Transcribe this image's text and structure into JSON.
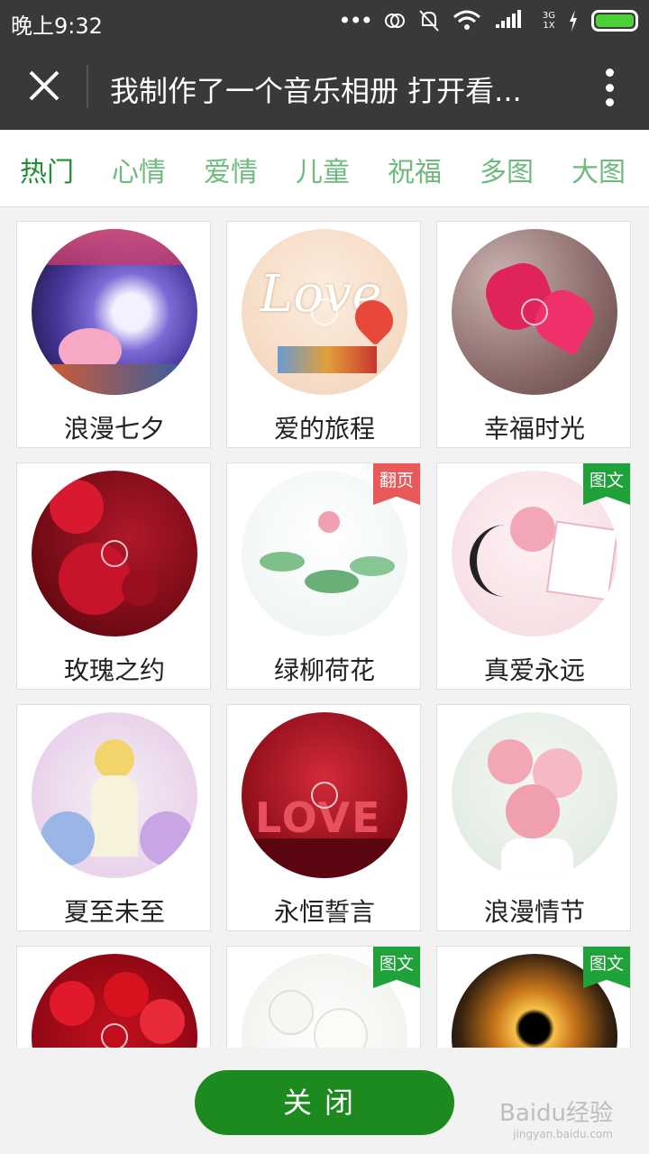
{
  "status": {
    "time": "晚上9:32",
    "network_top": "3G",
    "network_bottom": "1X"
  },
  "header": {
    "title": "我制作了一个音乐相册 打开看..."
  },
  "tabs": [
    {
      "label": "热门",
      "active": true
    },
    {
      "label": "心情",
      "active": false
    },
    {
      "label": "爱情",
      "active": false
    },
    {
      "label": "儿童",
      "active": false
    },
    {
      "label": "祝福",
      "active": false
    },
    {
      "label": "多图",
      "active": false
    },
    {
      "label": "大图",
      "active": false
    }
  ],
  "albums": [
    {
      "label": "浪漫七夕",
      "badge": "",
      "art": "qixi"
    },
    {
      "label": "爱的旅程",
      "badge": "",
      "art": "love-journey"
    },
    {
      "label": "幸福时光",
      "badge": "",
      "art": "hearts"
    },
    {
      "label": "玫瑰之约",
      "badge": "",
      "art": "red-roses"
    },
    {
      "label": "绿柳荷花",
      "badge": "翻页",
      "art": "lotus"
    },
    {
      "label": "真爱永远",
      "badge": "图文",
      "art": "pink-gift"
    },
    {
      "label": "夏至未至",
      "badge": "",
      "art": "girl-flowers"
    },
    {
      "label": "永恒誓言",
      "badge": "",
      "art": "love-bokeh"
    },
    {
      "label": "浪漫情节",
      "badge": "",
      "art": "pink-roses"
    },
    {
      "label": "",
      "badge": "",
      "art": "rose-bouquet"
    },
    {
      "label": "",
      "badge": "图文",
      "art": "white-blossom"
    },
    {
      "label": "",
      "badge": "图文",
      "art": "fire-ring"
    }
  ],
  "badge_colors": {
    "翻页": "#e85a5a",
    "图文": "#1fa23a"
  },
  "footer": {
    "close_label": "关闭"
  },
  "watermark": {
    "brand": "Baidu经验",
    "url": "jingyan.baidu.com"
  },
  "colors": {
    "tab_active": "#1f8f33",
    "tab_inactive": "#6dbb7d",
    "button": "#1c8a1f",
    "bar": "#39393b"
  }
}
